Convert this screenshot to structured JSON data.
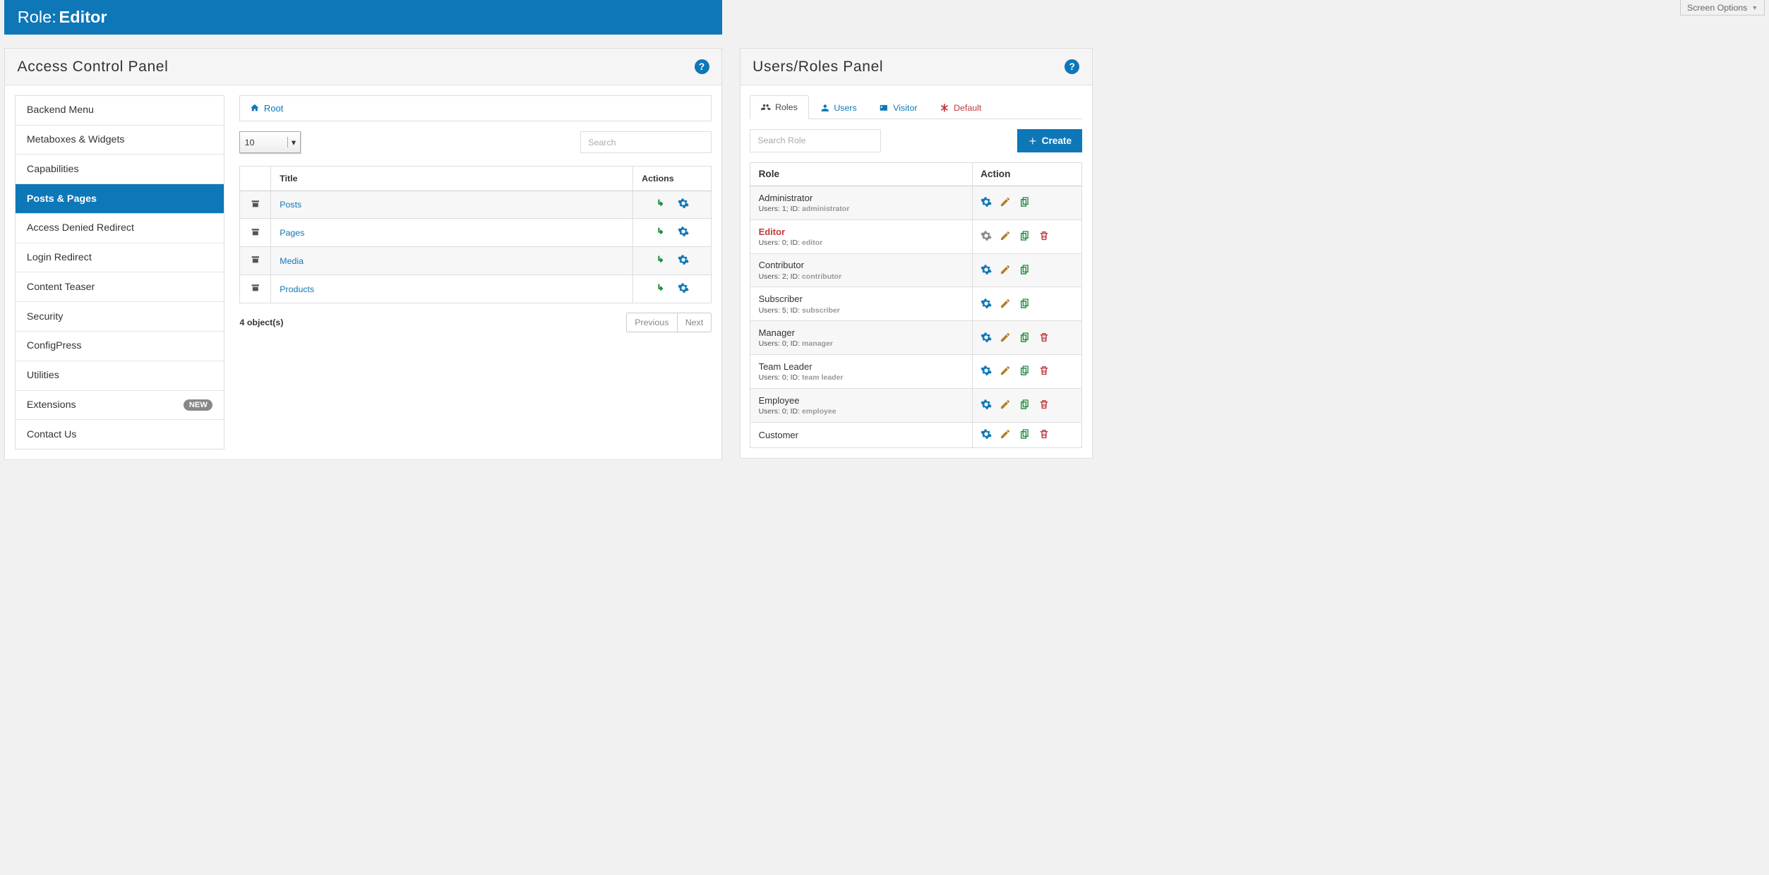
{
  "top": {
    "screen_options": "Screen Options"
  },
  "header": {
    "role_label": "Role:",
    "role_name": "Editor"
  },
  "left_panel": {
    "title": "Access Control Panel",
    "nav": [
      {
        "label": "Backend Menu",
        "active": false
      },
      {
        "label": "Metaboxes & Widgets",
        "active": false
      },
      {
        "label": "Capabilities",
        "active": false
      },
      {
        "label": "Posts & Pages",
        "active": true
      },
      {
        "label": "Access Denied Redirect",
        "active": false
      },
      {
        "label": "Login Redirect",
        "active": false
      },
      {
        "label": "Content Teaser",
        "active": false
      },
      {
        "label": "Security",
        "active": false
      },
      {
        "label": "ConfigPress",
        "active": false
      },
      {
        "label": "Utilities",
        "active": false
      },
      {
        "label": "Extensions",
        "active": false,
        "badge": "NEW"
      },
      {
        "label": "Contact Us",
        "active": false
      }
    ],
    "breadcrumb": "Root",
    "page_size": "10",
    "search_placeholder": "Search",
    "table": {
      "columns": {
        "title": "Title",
        "actions": "Actions"
      },
      "rows": [
        {
          "title": "Posts"
        },
        {
          "title": "Pages"
        },
        {
          "title": "Media"
        },
        {
          "title": "Products"
        }
      ],
      "count_text": "4 object(s)",
      "prev": "Previous",
      "next": "Next"
    }
  },
  "right_panel": {
    "title": "Users/Roles Panel",
    "tabs": {
      "roles": "Roles",
      "users": "Users",
      "visitor": "Visitor",
      "default": "Default"
    },
    "role_search_placeholder": "Search Role",
    "create_label": "Create",
    "table": {
      "columns": {
        "role": "Role",
        "action": "Action"
      },
      "rows": [
        {
          "name": "Administrator",
          "users": "1",
          "id": "administrator",
          "current": false,
          "deletable": false
        },
        {
          "name": "Editor",
          "users": "0",
          "id": "editor",
          "current": true,
          "deletable": true
        },
        {
          "name": "Contributor",
          "users": "2",
          "id": "contributor",
          "current": false,
          "deletable": false
        },
        {
          "name": "Subscriber",
          "users": "5",
          "id": "subscriber",
          "current": false,
          "deletable": false
        },
        {
          "name": "Manager",
          "users": "0",
          "id": "manager",
          "current": false,
          "deletable": true
        },
        {
          "name": "Team Leader",
          "users": "0",
          "id": "team leader",
          "current": false,
          "deletable": true
        },
        {
          "name": "Employee",
          "users": "0",
          "id": "employee",
          "current": false,
          "deletable": true
        },
        {
          "name": "Customer",
          "users": "",
          "id": "",
          "current": false,
          "deletable": true
        }
      ],
      "meta_users_label": "Users:",
      "meta_id_label": "ID:"
    }
  }
}
